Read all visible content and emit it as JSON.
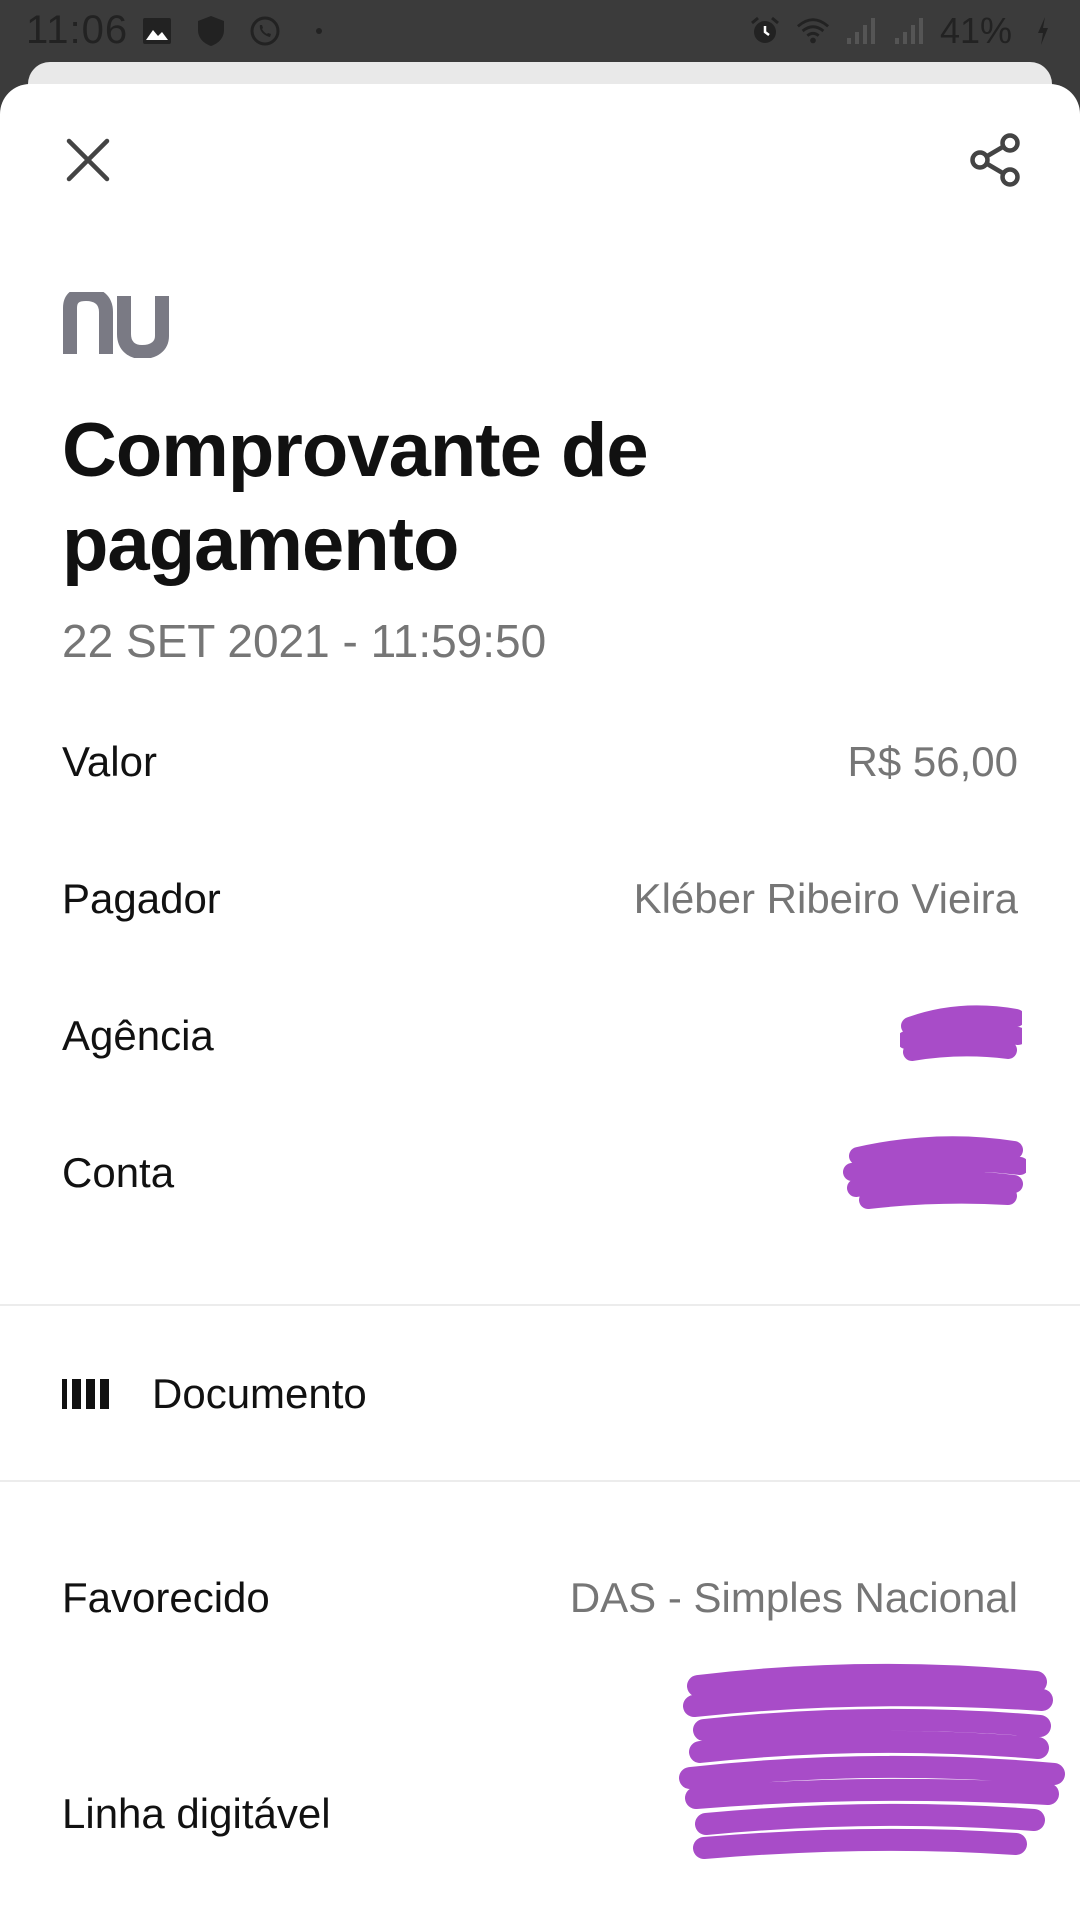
{
  "status_bar": {
    "time": "11:06",
    "battery": "41%",
    "icons": [
      "image-icon",
      "shield-icon",
      "whatsapp-icon",
      "dot-icon",
      "alarm-icon",
      "wifi-icon",
      "signal-icon",
      "signal-icon",
      "battery-charging-icon"
    ]
  },
  "header": {
    "close_icon": "close-icon",
    "share_icon": "share-icon"
  },
  "logo_text": "nu",
  "title": "Comprovante de pagamento",
  "datetime": "22 SET 2021 - 11:59:50",
  "details": {
    "valor": {
      "label": "Valor",
      "value": "R$ 56,00"
    },
    "pagador": {
      "label": "Pagador",
      "value": "Kléber Ribeiro Vieira"
    },
    "agencia": {
      "label": "Agência",
      "value": ""
    },
    "conta": {
      "label": "Conta",
      "value": ""
    }
  },
  "documento": {
    "icon": "barcode-icon",
    "title": "Documento"
  },
  "favorecido": {
    "label": "Favorecido",
    "value": "DAS - Simples Nacional"
  },
  "linha_digitavel": {
    "label": "Linha digitável"
  },
  "colors": {
    "text_primary": "#111111",
    "text_secondary": "#767676",
    "logo": "#7a7a84",
    "redaction": "#a84cc8",
    "divider": "#ececec"
  }
}
